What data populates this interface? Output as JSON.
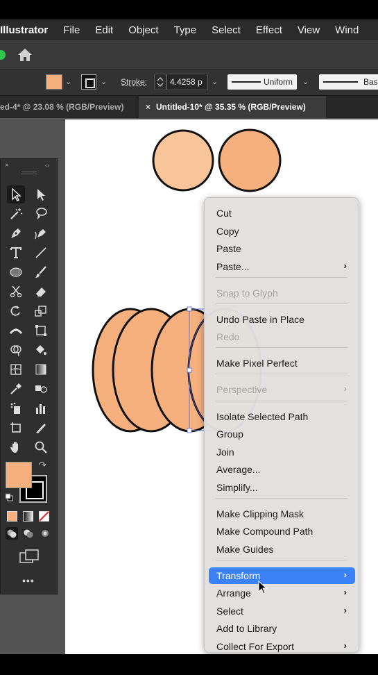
{
  "app_name": "Illustrator",
  "menu": [
    "File",
    "Edit",
    "Object",
    "Type",
    "Select",
    "Effect",
    "View",
    "Wind"
  ],
  "colors": {
    "fill": "#f6b07e",
    "fill_light": "#f8c49a",
    "accent": "#3b82f7",
    "window_dot": "#2fc84a"
  },
  "icons": {
    "home": "home-icon",
    "window_control": "zoom-window-dot"
  },
  "control_bar": {
    "stroke_label": "Stroke:",
    "stroke_weight": "4.4258 p",
    "profile": "Uniform",
    "brush": "Basi"
  },
  "tabs": [
    {
      "label": "ed-4* @ 23.08 % (RGB/Preview)"
    },
    {
      "close": "×",
      "label": "Untitled-10* @ 35.35 % (RGB/Preview)"
    }
  ],
  "toolbar": {
    "close": "×",
    "collapse": "‹›",
    "more": "•••",
    "tools": [
      "selection-tool",
      "direct-selection-tool",
      "magic-wand-tool",
      "lasso-tool",
      "pen-tool",
      "curvature-tool",
      "type-tool",
      "line-segment-tool",
      "ellipse-tool",
      "paintbrush-tool",
      "scissors-tool",
      "eraser-tool",
      "rotate-tool",
      "scale-tool",
      "width-tool",
      "free-transform-tool",
      "shape-builder-tool",
      "live-paint-tool",
      "mesh-tool",
      "gradient-tool",
      "eyedropper-tool",
      "blend-tool",
      "symbol-sprayer-tool",
      "column-graph-tool",
      "artboard-tool",
      "slice-tool",
      "hand-tool",
      "zoom-tool"
    ]
  },
  "context_menu": {
    "items": [
      {
        "label": "Cut",
        "disabled": false,
        "submenu": false
      },
      {
        "label": "Copy",
        "disabled": false,
        "submenu": false
      },
      {
        "label": "Paste",
        "disabled": false,
        "submenu": false
      },
      {
        "label": "Paste...",
        "disabled": false,
        "submenu": true
      },
      {
        "label": "Snap to Glyph",
        "disabled": true,
        "submenu": false
      },
      {
        "label": "Undo Paste in Place",
        "disabled": false,
        "submenu": false
      },
      {
        "label": "Redo",
        "disabled": true,
        "submenu": false
      },
      {
        "label": "Make Pixel Perfect",
        "disabled": false,
        "submenu": false
      },
      {
        "label": "Perspective",
        "disabled": true,
        "submenu": true
      },
      {
        "label": "Isolate Selected Path",
        "disabled": false,
        "submenu": false
      },
      {
        "label": "Group",
        "disabled": false,
        "submenu": false
      },
      {
        "label": "Join",
        "disabled": false,
        "submenu": false
      },
      {
        "label": "Average...",
        "disabled": false,
        "submenu": false
      },
      {
        "label": "Simplify...",
        "disabled": false,
        "submenu": false
      },
      {
        "label": "Make Clipping Mask",
        "disabled": false,
        "submenu": false
      },
      {
        "label": "Make Compound Path",
        "disabled": false,
        "submenu": false
      },
      {
        "label": "Make Guides",
        "disabled": false,
        "submenu": false
      },
      {
        "label": "Transform",
        "disabled": false,
        "submenu": true,
        "selected": true
      },
      {
        "label": "Arrange",
        "disabled": false,
        "submenu": true
      },
      {
        "label": "Select",
        "disabled": false,
        "submenu": true
      },
      {
        "label": "Add to Library",
        "disabled": false,
        "submenu": false
      },
      {
        "label": "Collect For Export",
        "disabled": false,
        "submenu": true
      }
    ],
    "submenu_arrow": "›"
  }
}
